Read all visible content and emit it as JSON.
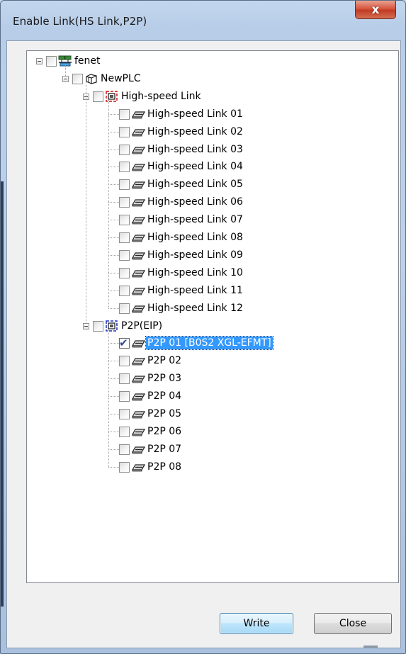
{
  "window": {
    "title": "Enable Link(HS Link,P2P)",
    "close_glyph": "x"
  },
  "tree": {
    "root": {
      "label": "fenet",
      "icon": "network-icon",
      "checked": false
    },
    "plc": {
      "label": "NewPLC",
      "icon": "plc-cube-icon",
      "checked": false
    },
    "hs_group": {
      "label": "High-speed Link",
      "icon": "hs-link-group-icon",
      "checked": false
    },
    "hs_items": [
      {
        "label": "High-speed Link 01",
        "checked": false
      },
      {
        "label": "High-speed Link 02",
        "checked": false
      },
      {
        "label": "High-speed Link 03",
        "checked": false
      },
      {
        "label": "High-speed Link 04",
        "checked": false
      },
      {
        "label": "High-speed Link 05",
        "checked": false
      },
      {
        "label": "High-speed Link 06",
        "checked": false
      },
      {
        "label": "High-speed Link 07",
        "checked": false
      },
      {
        "label": "High-speed Link 08",
        "checked": false
      },
      {
        "label": "High-speed Link 09",
        "checked": false
      },
      {
        "label": "High-speed Link 10",
        "checked": false
      },
      {
        "label": "High-speed Link 11",
        "checked": false
      },
      {
        "label": "High-speed Link 12",
        "checked": false
      }
    ],
    "p2p_group": {
      "label": "P2P(EIP)",
      "icon": "p2p-group-icon",
      "checked": false
    },
    "p2p_items": [
      {
        "label": "P2P 01 [B0S2 XGL-EFMT]",
        "checked": true,
        "selected": true
      },
      {
        "label": "P2P 02",
        "checked": false
      },
      {
        "label": "P2P 03",
        "checked": false
      },
      {
        "label": "P2P 04",
        "checked": false
      },
      {
        "label": "P2P 05",
        "checked": false
      },
      {
        "label": "P2P 06",
        "checked": false
      },
      {
        "label": "P2P 07",
        "checked": false
      },
      {
        "label": "P2P 08",
        "checked": false
      }
    ]
  },
  "buttons": {
    "write": "Write",
    "close": "Close"
  },
  "colors": {
    "selection": "#3399ff",
    "hs_group_icon": "#d01010",
    "p2p_group_icon": "#1a2fbf"
  }
}
